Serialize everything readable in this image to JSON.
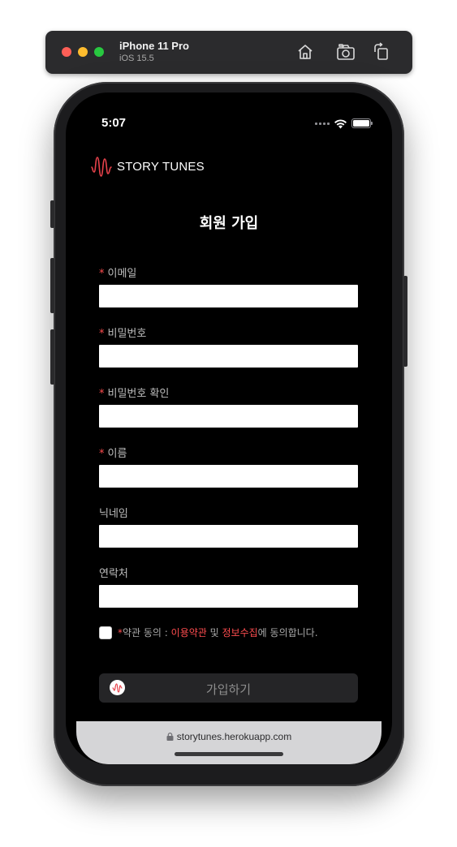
{
  "simulator": {
    "device_name": "iPhone 11 Pro",
    "os_version": "iOS 15.5",
    "icons": [
      "home-icon",
      "screenshot-icon",
      "rotate-icon"
    ]
  },
  "status_bar": {
    "time": "5:07"
  },
  "brand": {
    "name": "STORY TUNES",
    "color": "#e8424b"
  },
  "page": {
    "title": "회원 가입"
  },
  "form": {
    "required_mark": "*",
    "fields": [
      {
        "label": "이메일",
        "required": true,
        "value": ""
      },
      {
        "label": "비밀번호",
        "required": true,
        "value": ""
      },
      {
        "label": "비밀번호 확인",
        "required": true,
        "value": ""
      },
      {
        "label": "이름",
        "required": true,
        "value": ""
      },
      {
        "label": "닉네임",
        "required": false,
        "value": ""
      },
      {
        "label": "연락처",
        "required": false,
        "value": ""
      }
    ],
    "agreement": {
      "checked": false,
      "prefix_mark": "*",
      "text_before": "약관 동의 : ",
      "terms_link": "이용약관",
      "and": " 및 ",
      "privacy_link": "정보수집",
      "text_after": "에 동의합니다."
    },
    "submit_label": "가입하기"
  },
  "browser": {
    "url": "storytunes.herokuapp.com"
  },
  "colors": {
    "accent": "#ff4d4f",
    "screen_bg": "#000000",
    "button_bg": "#252527"
  }
}
